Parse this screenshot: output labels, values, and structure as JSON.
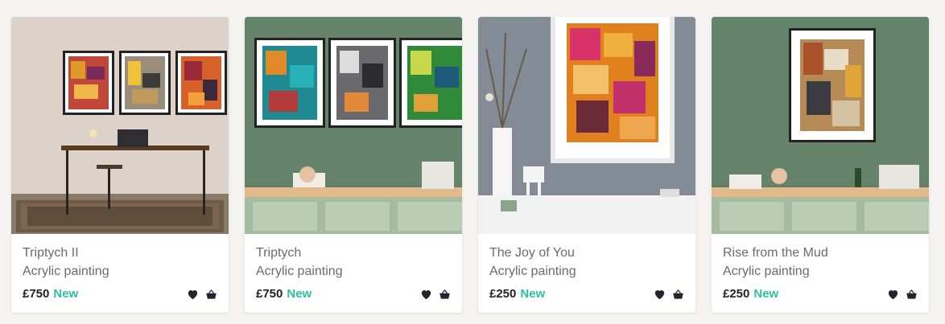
{
  "products": [
    {
      "title": "Triptych II",
      "medium": "Acrylic painting",
      "price": "£750",
      "badge": "New",
      "scene": "office"
    },
    {
      "title": "Triptych",
      "medium": "Acrylic painting",
      "price": "£750",
      "badge": "New",
      "scene": "kitchen-triptych"
    },
    {
      "title": "The Joy of You",
      "medium": "Acrylic painting",
      "price": "£250",
      "badge": "New",
      "scene": "grey-wall"
    },
    {
      "title": "Rise from the Mud",
      "medium": "Acrylic painting",
      "price": "£250",
      "badge": "New",
      "scene": "kitchen-single"
    }
  ],
  "icons": {
    "favourite": "heart-icon",
    "basket": "basket-icon"
  },
  "colors": {
    "accent": "#2dbfa0",
    "price": "#222222",
    "text_muted": "#6b6b6b"
  }
}
